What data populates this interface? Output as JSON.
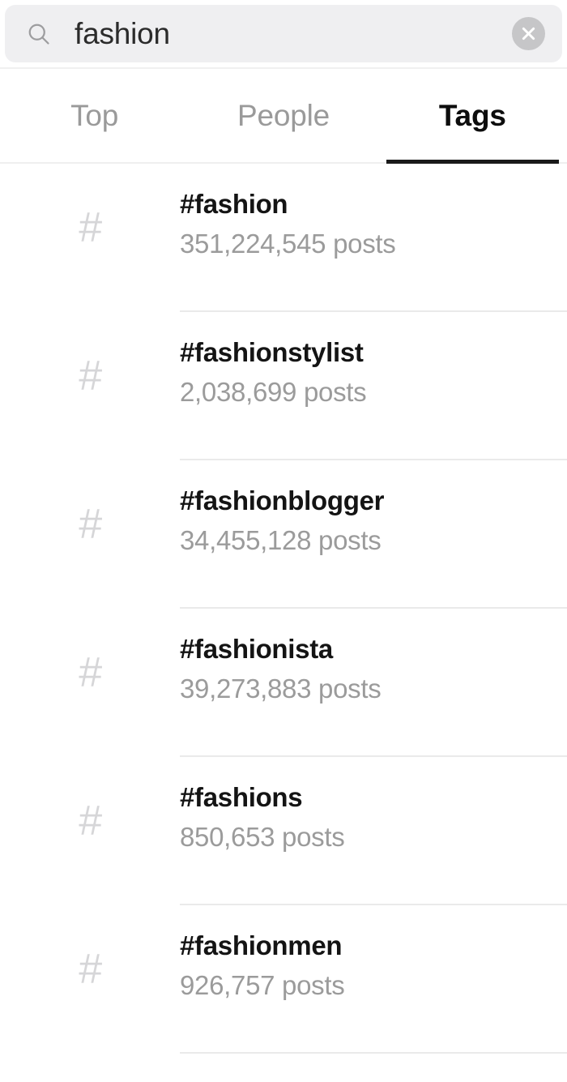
{
  "search": {
    "value": "fashion",
    "placeholder": "Search",
    "icon": "search-icon",
    "clear_icon": "close-circle-icon"
  },
  "tabs": [
    {
      "label": "Top",
      "active": false
    },
    {
      "label": "People",
      "active": false
    },
    {
      "label": "Tags",
      "active": true
    }
  ],
  "results": [
    {
      "icon": "hash-icon",
      "name": "#fashion",
      "posts": "351,224,545 posts"
    },
    {
      "icon": "hash-icon",
      "name": "#fashionstylist",
      "posts": "2,038,699 posts"
    },
    {
      "icon": "hash-icon",
      "name": "#fashionblogger",
      "posts": "34,455,128 posts"
    },
    {
      "icon": "hash-icon",
      "name": "#fashionista",
      "posts": "39,273,883 posts"
    },
    {
      "icon": "hash-icon",
      "name": "#fashions",
      "posts": "850,653 posts"
    },
    {
      "icon": "hash-icon",
      "name": "#fashionmen",
      "posts": "926,757 posts"
    }
  ],
  "colors": {
    "search_background": "#efeff1",
    "clear_button": "#c6c6c8",
    "active_tab": "#1a1a1a",
    "inactive_tab": "#9a9a9a",
    "tag_name": "#141414",
    "tag_posts": "#9b9b9b",
    "hash_icon": "#d6d6d8",
    "divider": "#eaeaea"
  }
}
